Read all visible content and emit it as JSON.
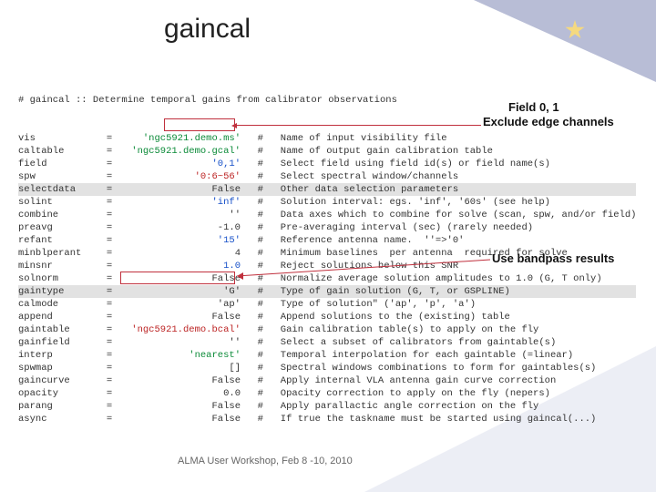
{
  "title": "gaincal",
  "header_comment": "# gaincal :: Determine temporal gains from calibrator observations",
  "rows": [
    {
      "name": "vis",
      "eq": "=",
      "cls": "green",
      "val": "'ngc5921.demo.ms'",
      "c": "#   Name of input visibility file",
      "hl": false
    },
    {
      "name": "caltable",
      "eq": "=",
      "cls": "green",
      "val": "'ngc5921.demo.gcal'",
      "c": "#   Name of output gain calibration table",
      "hl": false
    },
    {
      "name": "field",
      "eq": "=",
      "cls": "blue",
      "val": "'0,1'",
      "c": "#   Select field using field id(s) or field name(s)",
      "hl": false
    },
    {
      "name": "spw",
      "eq": "=",
      "cls": "red",
      "val": "'0:6~56'",
      "c": "#   Select spectral window/channels",
      "hl": false
    },
    {
      "name": "selectdata",
      "eq": "=",
      "cls": "",
      "val": "False",
      "c": "#   Other data selection parameters",
      "hl": true
    },
    {
      "name": "solint",
      "eq": "=",
      "cls": "blue",
      "val": "'inf'",
      "c": "#   Solution interval: egs. 'inf', '60s' (see help)",
      "hl": false
    },
    {
      "name": "combine",
      "eq": "=",
      "cls": "",
      "val": "''",
      "c": "#   Data axes which to combine for solve (scan, spw, and/or field)",
      "hl": false
    },
    {
      "name": "preavg",
      "eq": "=",
      "cls": "",
      "val": "-1.0",
      "c": "#   Pre-averaging interval (sec) (rarely needed)",
      "hl": false
    },
    {
      "name": "refant",
      "eq": "=",
      "cls": "blue",
      "val": "'15'",
      "c": "#   Reference antenna name.  ''=>'0'",
      "hl": false
    },
    {
      "name": "minblperant",
      "eq": "=",
      "cls": "",
      "val": "4",
      "c": "#   Minimum baselines  per antenna  required for solve",
      "hl": false
    },
    {
      "name": "minsnr",
      "eq": "=",
      "cls": "blue",
      "val": "1.0",
      "c": "#   Reject solutions below this SNR",
      "hl": false
    },
    {
      "name": "solnorm",
      "eq": "=",
      "cls": "",
      "val": "False",
      "c": "#   Normalize average solution amplitudes to 1.0 (G, T only)",
      "hl": false
    },
    {
      "name": "gaintype",
      "eq": "=",
      "cls": "",
      "val": "'G'",
      "c": "#   Type of gain solution (G, T, or GSPLINE)",
      "hl": true
    },
    {
      "name": "calmode",
      "eq": "=",
      "cls": "",
      "val": "'ap'",
      "c": "#   Type of solution\" ('ap', 'p', 'a')",
      "hl": false
    },
    {
      "name": "append",
      "eq": "=",
      "cls": "",
      "val": "False",
      "c": "#   Append solutions to the (existing) table",
      "hl": false
    },
    {
      "name": "gaintable",
      "eq": "=",
      "cls": "red",
      "val": "'ngc5921.demo.bcal'",
      "c": "#   Gain calibration table(s) to apply on the fly",
      "hl": false
    },
    {
      "name": "gainfield",
      "eq": "=",
      "cls": "",
      "val": "''",
      "c": "#   Select a subset of calibrators from gaintable(s)",
      "hl": false
    },
    {
      "name": "interp",
      "eq": "=",
      "cls": "green",
      "val": "'nearest'",
      "c": "#   Temporal interpolation for each gaintable (=linear)",
      "hl": false
    },
    {
      "name": "spwmap",
      "eq": "=",
      "cls": "",
      "val": "[]",
      "c": "#   Spectral windows combinations to form for gaintables(s)",
      "hl": false
    },
    {
      "name": "gaincurve",
      "eq": "=",
      "cls": "",
      "val": "False",
      "c": "#   Apply internal VLA antenna gain curve correction",
      "hl": false
    },
    {
      "name": "opacity",
      "eq": "=",
      "cls": "",
      "val": "0.0",
      "c": "#   Opacity correction to apply on the fly (nepers)",
      "hl": false
    },
    {
      "name": "parang",
      "eq": "=",
      "cls": "",
      "val": "False",
      "c": "#   Apply parallactic angle correction on the fly",
      "hl": false
    },
    {
      "name": "async",
      "eq": "=",
      "cls": "",
      "val": "False",
      "c": "#   If true the taskname must be started using gaincal(...)",
      "hl": false
    }
  ],
  "annotations": {
    "field": "Field 0, 1",
    "exclude": "Exclude edge channels",
    "bandpass": "Use bandpass results"
  },
  "footer": "ALMA User Workshop, Feb 8 -10, 2010"
}
